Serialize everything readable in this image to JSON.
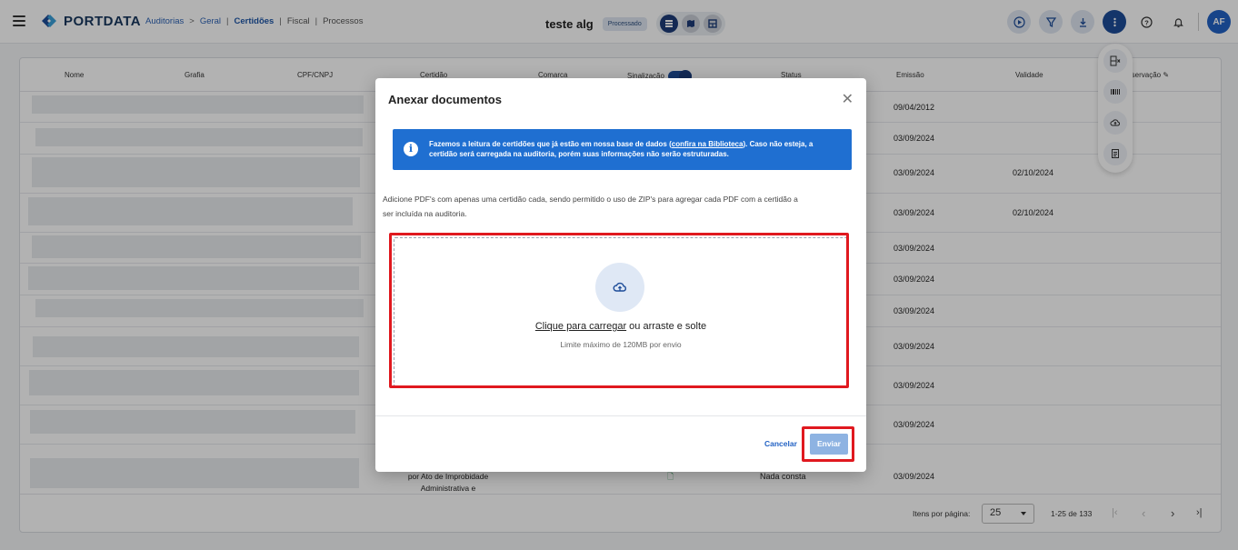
{
  "header": {
    "logo_text": "PORTDATA",
    "breadcrumbs": [
      "Auditorias",
      ">",
      "Geral",
      "|",
      "Certidões",
      "|",
      "Fiscal",
      "|",
      "Processos"
    ],
    "audit_title": "teste alg",
    "status_badge": "Processado",
    "avatar_initials": "AF"
  },
  "table": {
    "columns": [
      "Nome",
      "Grafia",
      "CPF/CNPJ",
      "Certidão",
      "Comarca",
      "Sinalização",
      "Status",
      "Emissão",
      "Validade",
      "Observação"
    ],
    "rows": [
      {
        "emissao": "09/04/2012",
        "validade": ""
      },
      {
        "emissao": "03/09/2024",
        "validade": ""
      },
      {
        "emissao": "03/09/2024",
        "validade": "02/10/2024"
      },
      {
        "emissao": "03/09/2024",
        "validade": "02/10/2024"
      },
      {
        "emissao": "03/09/2024",
        "validade": ""
      },
      {
        "emissao": "03/09/2024",
        "validade": ""
      },
      {
        "emissao": "03/09/2024",
        "validade": ""
      },
      {
        "emissao": "03/09/2024",
        "validade": ""
      },
      {
        "emissao": "03/09/2024",
        "validade": ""
      },
      {
        "emissao": "03/09/2024",
        "validade": ""
      }
    ],
    "last_row": {
      "certidao_line1": "por Ato de Improbidade",
      "certidao_line2": "Administrativa e",
      "status": "Nada consta",
      "emissao": "03/09/2024"
    },
    "pager": {
      "items_label": "Itens por página:",
      "items_value": "25",
      "range": "1-25 de 133"
    }
  },
  "modal": {
    "title": "Anexar documentos",
    "info_part1": "Fazemos a leitura de certidões que já estão em nossa base de dados (",
    "info_link": "confira na Biblioteca",
    "info_part2": "). Caso não esteja, a certidão será carregada na auditoria, porém suas informações não serão estruturadas.",
    "description": "Adicione PDF's com apenas uma certidão cada, sendo permitido o uso de ZIP's para agregar cada PDF com a certidão a ser incluída na auditoria.",
    "upload_link": "Clique para carregar",
    "upload_rest": " ou arraste e solte",
    "upload_limit": "Limite máximo de 120MB por envio",
    "cancel_label": "Cancelar",
    "send_label": "Enviar"
  },
  "colors": {
    "primary": "#1d4c99",
    "info_bg": "#1f6fd1",
    "highlight": "#e0191f",
    "send_disabled": "#8eb3e2"
  }
}
